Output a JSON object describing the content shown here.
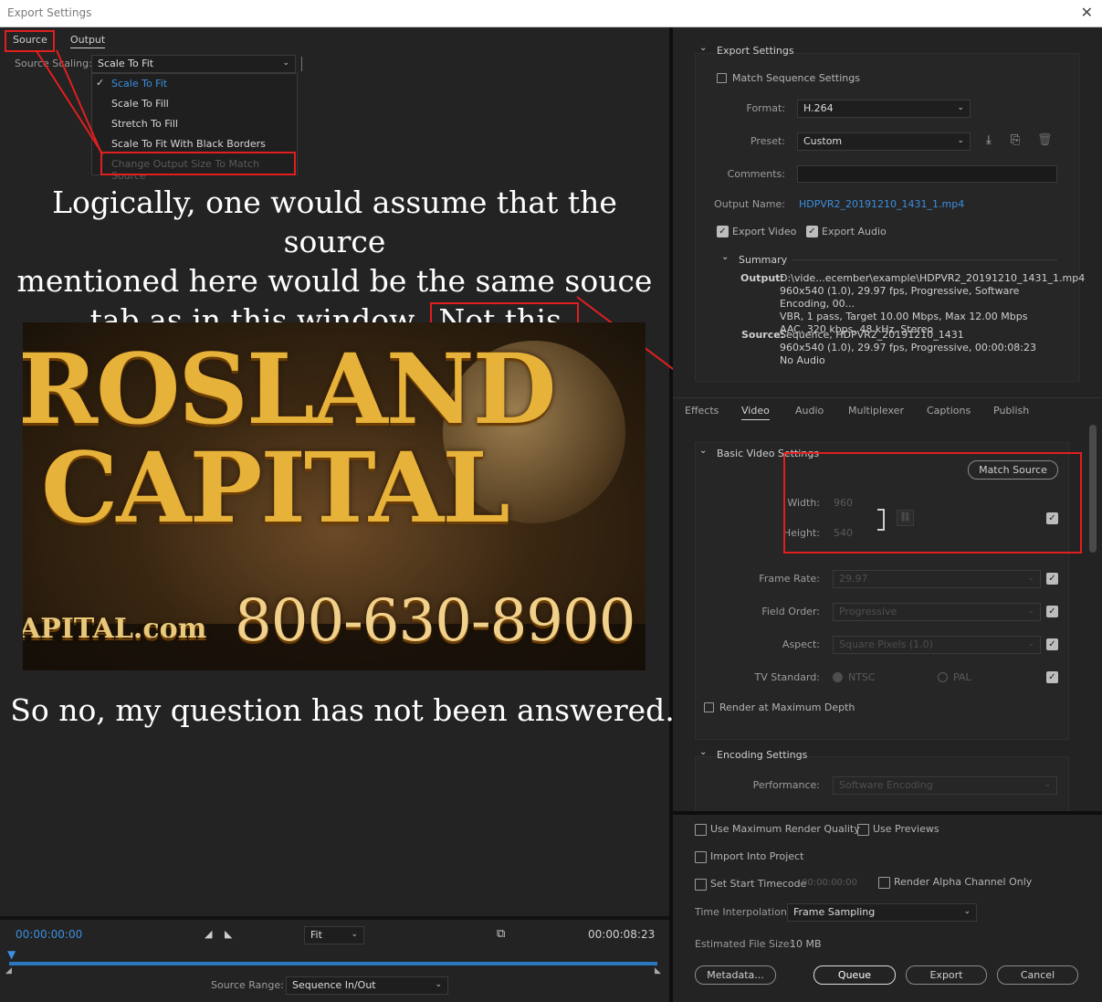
{
  "window": {
    "title": "Export Settings",
    "close_icon": "close-icon"
  },
  "left": {
    "tabs": [
      {
        "label": "Source"
      },
      {
        "label": "Output"
      }
    ],
    "source_scaling": {
      "label": "Source Scaling:",
      "value": "Scale To Fit",
      "options": [
        "Scale To Fit",
        "Scale To Fill",
        "Stretch To Fill",
        "Scale To Fit With Black Borders",
        "Change Output Size To Match Source"
      ]
    },
    "annotation": {
      "line1": "Logically, one would assume that the source",
      "line2": "mentioned here would be the same souce",
      "line3": "tab as in this window.",
      "not_this": "Not this.",
      "bottom": "So no, my question has not been answered."
    },
    "preview": {
      "line1": "ROSLAND",
      "line2": "CAPITAL",
      "domain": "APITAL.com",
      "phone": "800-630-8900"
    },
    "timeline": {
      "current": "00:00:00:00",
      "zoom": "Fit",
      "duration": "00:00:08:23",
      "source_range_label": "Source Range:",
      "source_range": "Sequence In/Out"
    }
  },
  "right": {
    "export_settings": {
      "header": "Export Settings",
      "match_sequence": "Match Sequence Settings",
      "format_label": "Format:",
      "format": "H.264",
      "preset_label": "Preset:",
      "preset": "Custom",
      "comments_label": "Comments:",
      "output_name_label": "Output Name:",
      "output_name": "HDPVR2_20191210_1431_1.mp4",
      "export_video": "Export Video",
      "export_audio": "Export Audio",
      "summary": {
        "header": "Summary",
        "output_label": "Output:",
        "output_lines": [
          "D:\\vide...ecember\\example\\HDPVR2_20191210_1431_1.mp4",
          "960x540 (1.0), 29.97 fps, Progressive, Software Encoding, 00...",
          "VBR, 1 pass, Target 10.00 Mbps, Max 12.00 Mbps",
          "AAC, 320 kbps, 48 kHz, Stereo"
        ],
        "source_label": "Source:",
        "source_lines": [
          "Sequence, HDPVR2_20191210_1431",
          "960x540 (1.0), 29.97 fps, Progressive, 00:00:08:23",
          "No Audio"
        ]
      }
    },
    "tabs": [
      "Effects",
      "Video",
      "Audio",
      "Multiplexer",
      "Captions",
      "Publish"
    ],
    "basic_video": {
      "header": "Basic Video Settings",
      "match_source": "Match Source",
      "width_label": "Width:",
      "width": "960",
      "height_label": "Height:",
      "height": "540",
      "frame_rate_label": "Frame Rate:",
      "frame_rate": "29.97",
      "field_order_label": "Field Order:",
      "field_order": "Progressive",
      "aspect_label": "Aspect:",
      "aspect": "Square Pixels (1.0)",
      "tv_standard_label": "TV Standard:",
      "ntsc": "NTSC",
      "pal": "PAL",
      "render_max_depth": "Render at Maximum Depth"
    },
    "encoding": {
      "header": "Encoding Settings",
      "performance_label": "Performance:",
      "performance": "Software Encoding"
    },
    "bottom": {
      "use_max_render": "Use Maximum Render Quality",
      "use_previews": "Use Previews",
      "import_into_project": "Import Into Project",
      "set_start_timecode": "Set Start Timecode",
      "start_timecode": "00:00:00:00",
      "render_alpha": "Render Alpha Channel Only",
      "time_interp_label": "Time Interpolation:",
      "time_interp": "Frame Sampling",
      "file_size_label": "Estimated File Size:",
      "file_size": "10 MB",
      "metadata": "Metadata...",
      "queue": "Queue",
      "export": "Export",
      "cancel": "Cancel"
    }
  },
  "colors": {
    "accent": "#2a78c0",
    "annotation": "#e01f1f",
    "link": "#3b8fe0"
  }
}
